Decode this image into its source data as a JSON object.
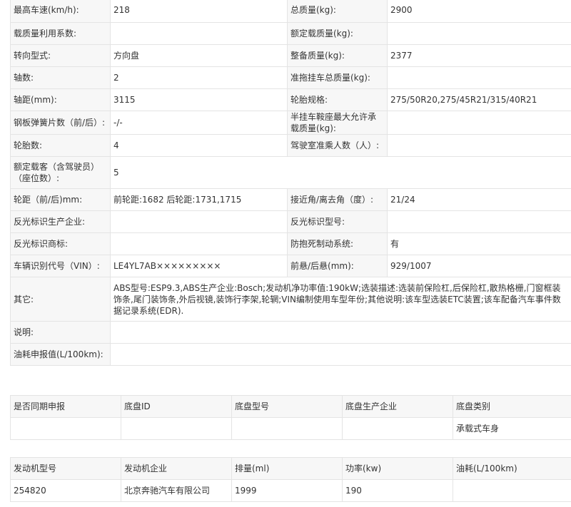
{
  "spec_rows": [
    [
      {
        "l": "最高车速(km/h):",
        "v": "218"
      },
      {
        "l": "总质量(kg):",
        "v": "2900"
      }
    ],
    [
      {
        "l": "载质量利用系数:",
        "v": ""
      },
      {
        "l": "额定载质量(kg):",
        "v": ""
      }
    ],
    [
      {
        "l": "转向型式:",
        "v": "方向盘"
      },
      {
        "l": "整备质量(kg):",
        "v": "2377"
      }
    ],
    [
      {
        "l": "轴数:",
        "v": "2"
      },
      {
        "l": "准拖挂车总质量(kg):",
        "v": ""
      }
    ],
    [
      {
        "l": "轴距(mm):",
        "v": "3115"
      },
      {
        "l": "轮胎规格:",
        "v": "275/50R20,275/45R21/315/40R21"
      }
    ],
    [
      {
        "l": "钢板弹簧片数（前/后）:",
        "v": "-/-"
      },
      {
        "l": "半挂车鞍座最大允许承载质量(kg):",
        "v": ""
      }
    ],
    [
      {
        "l": "轮胎数:",
        "v": "4"
      },
      {
        "l": "驾驶室准乘人数（人）:",
        "v": ""
      }
    ],
    [
      {
        "l": "额定载客（含驾驶员）（座位数）:",
        "v": "5"
      }
    ],
    [
      {
        "l": "轮距（前/后)mm:",
        "v": "前轮距:1682 后轮距:1731,1715"
      },
      {
        "l": "接近角/离去角（度）:",
        "v": "21/24"
      }
    ],
    [
      {
        "l": "反光标识生产企业:",
        "v": ""
      },
      {
        "l": "反光标识型号:",
        "v": ""
      }
    ],
    [
      {
        "l": "反光标识商标:",
        "v": ""
      },
      {
        "l": "防抱死制动系统:",
        "v": "有"
      }
    ],
    [
      {
        "l": "车辆识别代号（VIN）:",
        "v": "LE4YL7AB×××××××××"
      },
      {
        "l": "前悬/后悬(mm):",
        "v": "929/1007"
      }
    ],
    [
      {
        "l": "其它:",
        "v": "ABS型号:ESP9.3,ABS生产企业:Bosch;发动机净功率值:190kW;选装描述:选装前保险杠,后保险杠,散热格栅,门窗框装饰条,尾门装饰条,外后视镜,装饰行李架,轮辋;VIN编制使用车型年份;其他说明:该车型选装ETC装置;该车配备汽车事件数据记录系统(EDR)."
      }
    ],
    [
      {
        "l": "说明:",
        "v": ""
      }
    ],
    [
      {
        "l": "油耗申报值(L/100km):",
        "v": ""
      }
    ]
  ],
  "chassis": {
    "headers": [
      "是否同期申报",
      "底盘ID",
      "底盘型号",
      "底盘生产企业",
      "底盘类别"
    ],
    "row": [
      "",
      "",
      "",
      "",
      "承载式车身"
    ]
  },
  "engine": {
    "headers": [
      "发动机型号",
      "发动机企业",
      "排量(ml)",
      "功率(kw)",
      "油耗(L/100km)"
    ],
    "row": [
      "254820",
      "北京奔驰汽车有限公司",
      "1999",
      "190",
      ""
    ]
  }
}
